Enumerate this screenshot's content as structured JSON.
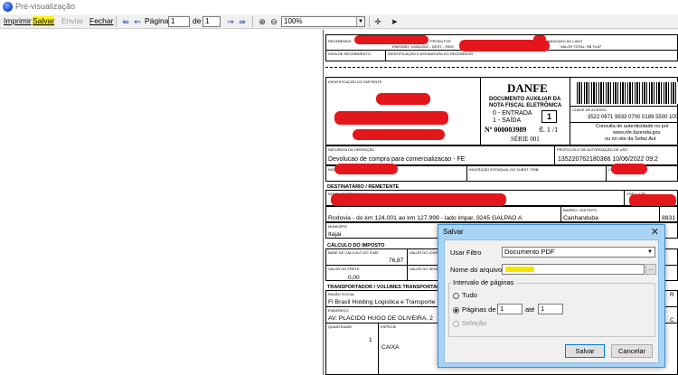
{
  "window": {
    "title": "Pré-visualização"
  },
  "toolbar": {
    "print": "Imprimir",
    "save": "Salvar",
    "send": "Enviar",
    "close": "Fechar",
    "page_label": "Página",
    "page_value": "1",
    "of_label": "de",
    "total_pages": "1",
    "zoom": "100%"
  },
  "danfe": {
    "receipt_header": "RECEBEMOS",
    "receipt_products": "PRODUTOS",
    "receipt_indicated": "INDICADO AO LADO",
    "emission": "EMISSÃO: 10/06/2022 - DEST. / REM",
    "total_value": "VALOR TOTAL: R$ 76,87",
    "receipt_date_label": "DATA DE RECEBIMENTO",
    "receipt_sign_label": "IDENTIFICAÇÃO E ASSINATURA DO RECEBEDOR",
    "issuer_label": "IDENTIFICAÇÃO DO EMITENTE",
    "title": "DANFE",
    "subtitle_1": "DOCUMENTO AUXILIAR DA",
    "subtitle_2": "NOTA FISCAL ELETRÔNICA",
    "entry": "0 - ENTRADA",
    "exit": "1 - SAÍDA",
    "type_value": "1",
    "number": "Nº 000003989",
    "sheet": "fl. 1 /1",
    "series": "SÉRIE 001",
    "access_key_label": "CHAVE DE ACESSO",
    "access_key": "3522 0671 9933 0700 0189 5500 100",
    "auth_text_1": "Consulta de autenticidade no por",
    "auth_text_2": "www.nfe.fazenda.gov.",
    "auth_text_3": "ou no site da Sefaz Aut",
    "nature_label": "NATUREZA DA OPERAÇÃO",
    "nature": "Devolucao de compra para comercializacao - FE",
    "protocol_label": "PROTOCOLO DE AUTORIZAÇÃO DE USO",
    "protocol": "135220762180366 10/06/2022 09:2",
    "state_reg_label": "INSCRIÇÃO ESTADUAL",
    "state_reg_sub_label": "INSCRIÇÃO ESTADUAL DO SUBST. TRIB.",
    "cnpj_label": "CNPJ / CPF",
    "recipient_header": "DESTINATÁRIO / REMETENTE",
    "name_label": "NOME / RAZÃO SOCIAL",
    "address": "Rodovia - do km 124,001 ao km 127,999 - lado impar, 9245 GALPAO A",
    "district_label": "BAIRRO / DISTRITO",
    "district": "Canhanduba",
    "zip_partial": "8831",
    "city_label": "MUNICÍPIO",
    "city": "Itajai",
    "tax_header": "CÁLCULO DO IMPOSTO",
    "icms_base_label": "BASE DE CÁLCULO DO ICMS",
    "icms_value_label": "VALOR DO ICMS",
    "products_value": "76,87",
    "freight_label": "VALOR DO FRETE",
    "insurance_label": "VALOR DO SEGURO",
    "freight_value": "0,00",
    "transport_header": "TRANSPORTADOR / VOLUMES TRANSPORTADOS",
    "carrier_name_label": "RAZÃO SOCIAL",
    "carrier_name": "Fl Brasil Holding Logistica e Transporte",
    "carrier_address_label": "ENDEREÇO",
    "carrier_address": "AV. PLACIDO HUGO DE OLIVEIRA, 2",
    "qty_label": "QUANTIDADE",
    "species_label": "ESPÉCIE",
    "qty": "1",
    "species": "CAIXA",
    "right_c": "C",
    "right_r": "R"
  },
  "dialog": {
    "title": "Salvar",
    "filter_label": "Usar Filtro",
    "filter_value": "Documento PDF",
    "filename_label": "Nome do arquivo",
    "browse": "...",
    "range_group": "Intervalo de páginas",
    "all": "Tudo",
    "pages": "Páginas de",
    "pages_from": "1",
    "until": "até",
    "pages_to": "1",
    "selection": "Seleção",
    "save_button": "Salvar",
    "cancel_button": "Cancelar"
  },
  "colors": {
    "redaction": "#e3161b",
    "highlight": "#fff200",
    "dialog_frame": "#a9d4f3"
  }
}
